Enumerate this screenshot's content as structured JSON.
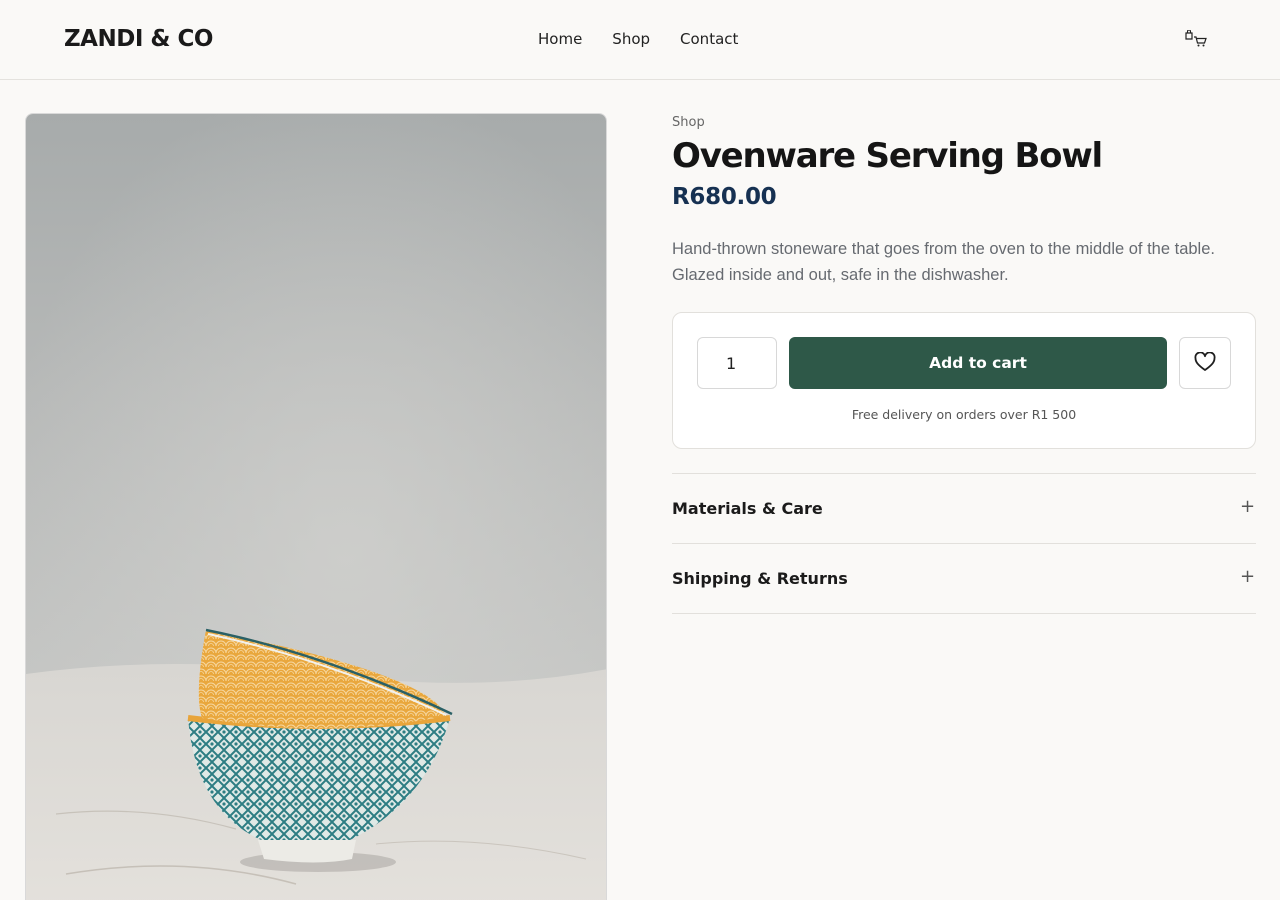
{
  "header": {
    "logo": "ZANDI & CO",
    "nav": [
      "Home",
      "Shop",
      "Contact"
    ],
    "cart_icon": "shopping-cart-icon"
  },
  "product": {
    "breadcrumb": "Shop",
    "title": "Ovenware Serving Bowl",
    "price": "R680.00",
    "description": "Hand-thrown stoneware that goes from the oven to the middle of the table. Glazed inside and out, safe in the dishwasher.",
    "quantity": "1",
    "add_to_cart": "Add to cart",
    "wishlist_icon": "heart-icon",
    "delivery_note": "Free delivery on orders over R1 500"
  },
  "accordion": [
    {
      "label": "Materials & Care",
      "icon": "plus-icon"
    },
    {
      "label": "Shipping & Returns",
      "icon": "plus-icon"
    }
  ],
  "colors": {
    "add_button": "#2e5848",
    "price": "#163152",
    "background": "#faf9f7"
  }
}
